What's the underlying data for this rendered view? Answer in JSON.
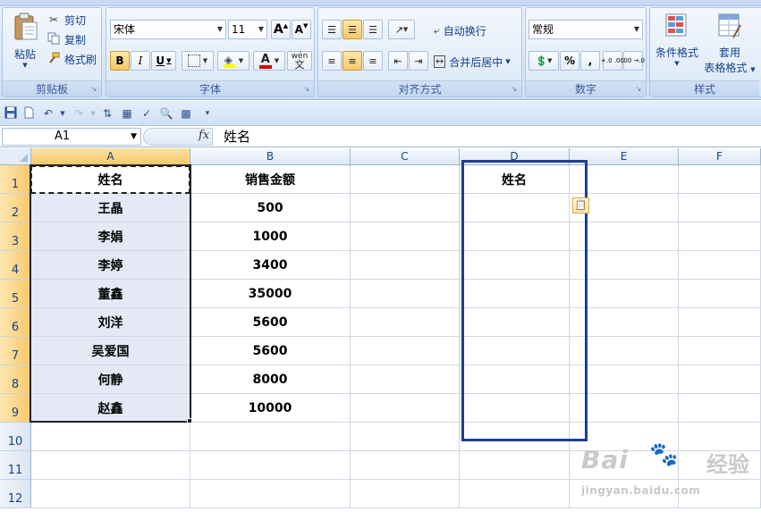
{
  "ribbon": {
    "clipboard": {
      "paste": "粘贴",
      "cut": "剪切",
      "copy": "复制",
      "format_painter": "格式刷",
      "label": "剪贴板"
    },
    "font": {
      "name": "宋体",
      "size": "11",
      "grow": "A",
      "shrink": "A",
      "bold": "B",
      "italic": "I",
      "underline": "U",
      "font_color_letter": "A",
      "phonetic": "wén",
      "label": "字体"
    },
    "alignment": {
      "wrap_text": "自动换行",
      "merge_center": "合并后居中",
      "label": "对齐方式"
    },
    "number": {
      "format": "常规",
      "percent": "%",
      "comma": ",",
      "inc_decimal": "+.0 .00",
      "dec_decimal": ".00 →.0",
      "label": "数字"
    },
    "styles": {
      "conditional": "条件格式",
      "table_format_1": "套用",
      "table_format_2": "表格格式",
      "label": "样式"
    }
  },
  "formula_bar": {
    "name_box": "A1",
    "fx": "fx",
    "content": "姓名"
  },
  "columns": [
    "A",
    "B",
    "C",
    "D",
    "E",
    "F"
  ],
  "rows": [
    "1",
    "2",
    "3",
    "4",
    "5",
    "6",
    "7",
    "8",
    "9",
    "10",
    "11",
    "12"
  ],
  "table": {
    "header_a": "姓名",
    "header_b": "销售金额",
    "header_d": "姓名",
    "names": [
      "王晶",
      "李娟",
      "李婷",
      "董鑫",
      "刘洋",
      "吴爱国",
      "何静",
      "赵鑫"
    ],
    "amounts": [
      "500",
      "1000",
      "3400",
      "35000",
      "5600",
      "5600",
      "8000",
      "10000"
    ]
  },
  "watermark": {
    "main": "Bai",
    "paw": "du",
    "cn": "经验",
    "url": "jingyan.baidu.com"
  },
  "colors": {
    "ribbon": "#dbe7f7",
    "selection": "#e4e9f5",
    "highlight_box": "#1b3f94",
    "header_selected": "#f9c96b"
  },
  "icons": [
    "paste-icon",
    "scissors-icon",
    "copy-icon",
    "brush-icon",
    "save-icon",
    "undo-icon",
    "redo-icon",
    "paste-options-icon"
  ]
}
